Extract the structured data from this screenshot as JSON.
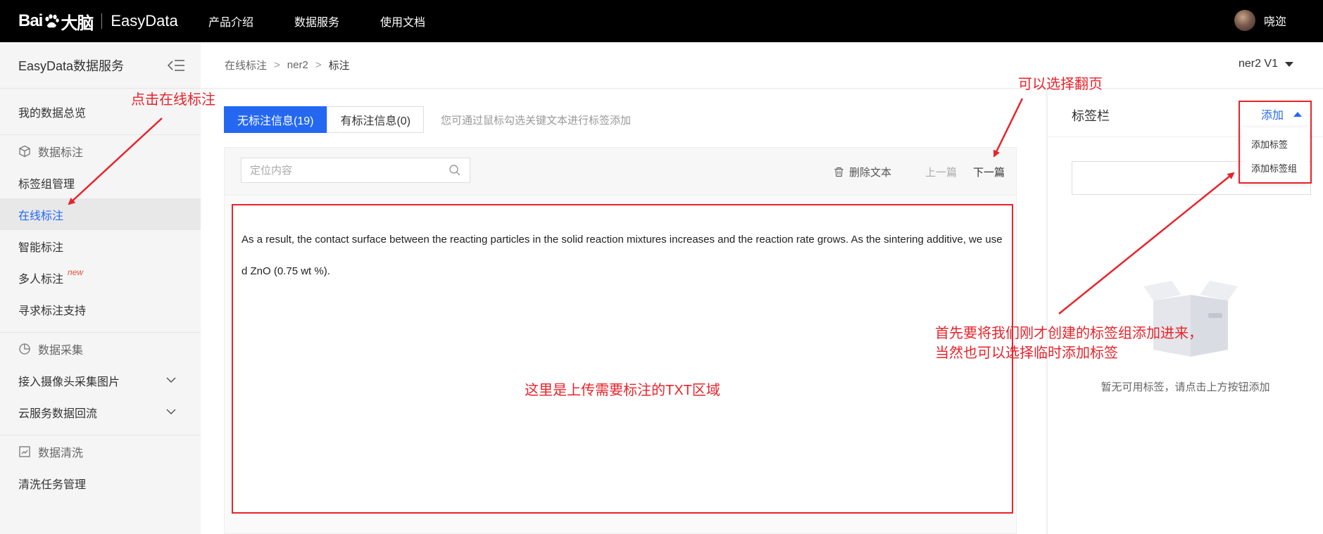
{
  "topbar": {
    "logo_text": "Bai",
    "logo_text2": "大脑",
    "product": "EasyData",
    "nav": [
      "产品介绍",
      "数据服务",
      "使用文档"
    ],
    "username": "哓迩"
  },
  "sidebar": {
    "title": "EasyData数据服务",
    "overview": "我的数据总览",
    "group_label": "数据标注",
    "items": [
      "标签组管理",
      "在线标注",
      "智能标注",
      "多人标注",
      "寻求标注支持"
    ],
    "new_badge": "new",
    "collect_group": "数据采集",
    "collect_items": [
      "接入摄像头采集图片",
      "云服务数据回流"
    ],
    "clean_group": "数据清洗",
    "clean_items": [
      "清洗任务管理"
    ]
  },
  "breadcrumb": {
    "items": [
      "在线标注",
      "ner2",
      "标注"
    ],
    "version": "ner2 V1"
  },
  "main": {
    "tabs": [
      "无标注信息(19)",
      "有标注信息(0)"
    ],
    "hint": "您可通过鼠标勾选关键文本进行标签添加",
    "search_placeholder": "定位内容",
    "delete_label": "删除文本",
    "prev_label": "上一篇",
    "next_label": "下一篇",
    "text": "As a result, the contact surface between the reacting particles in the solid reaction mixtures increases and the reaction rate grows. As the sintering additive, we used ZnO (0.75 wt %)."
  },
  "label_panel": {
    "title": "标签栏",
    "add_label": "添加",
    "dropdown": [
      "添加标签",
      "添加标签组"
    ],
    "empty_text": "暂无可用标签，请点击上方按钮添加"
  },
  "annotations": {
    "click_online": "点击在线标注",
    "page_turn": "可以选择翻页",
    "upload_area": "这里是上传需要标注的TXT区域",
    "add_group_line1": "首先要将我们刚才创建的标签组添加进来，",
    "add_group_line2": "当然也可以选择临时添加标签"
  },
  "colors": {
    "accent": "#2468f2",
    "annotation": "#e8232b",
    "topbar": "#000000"
  }
}
